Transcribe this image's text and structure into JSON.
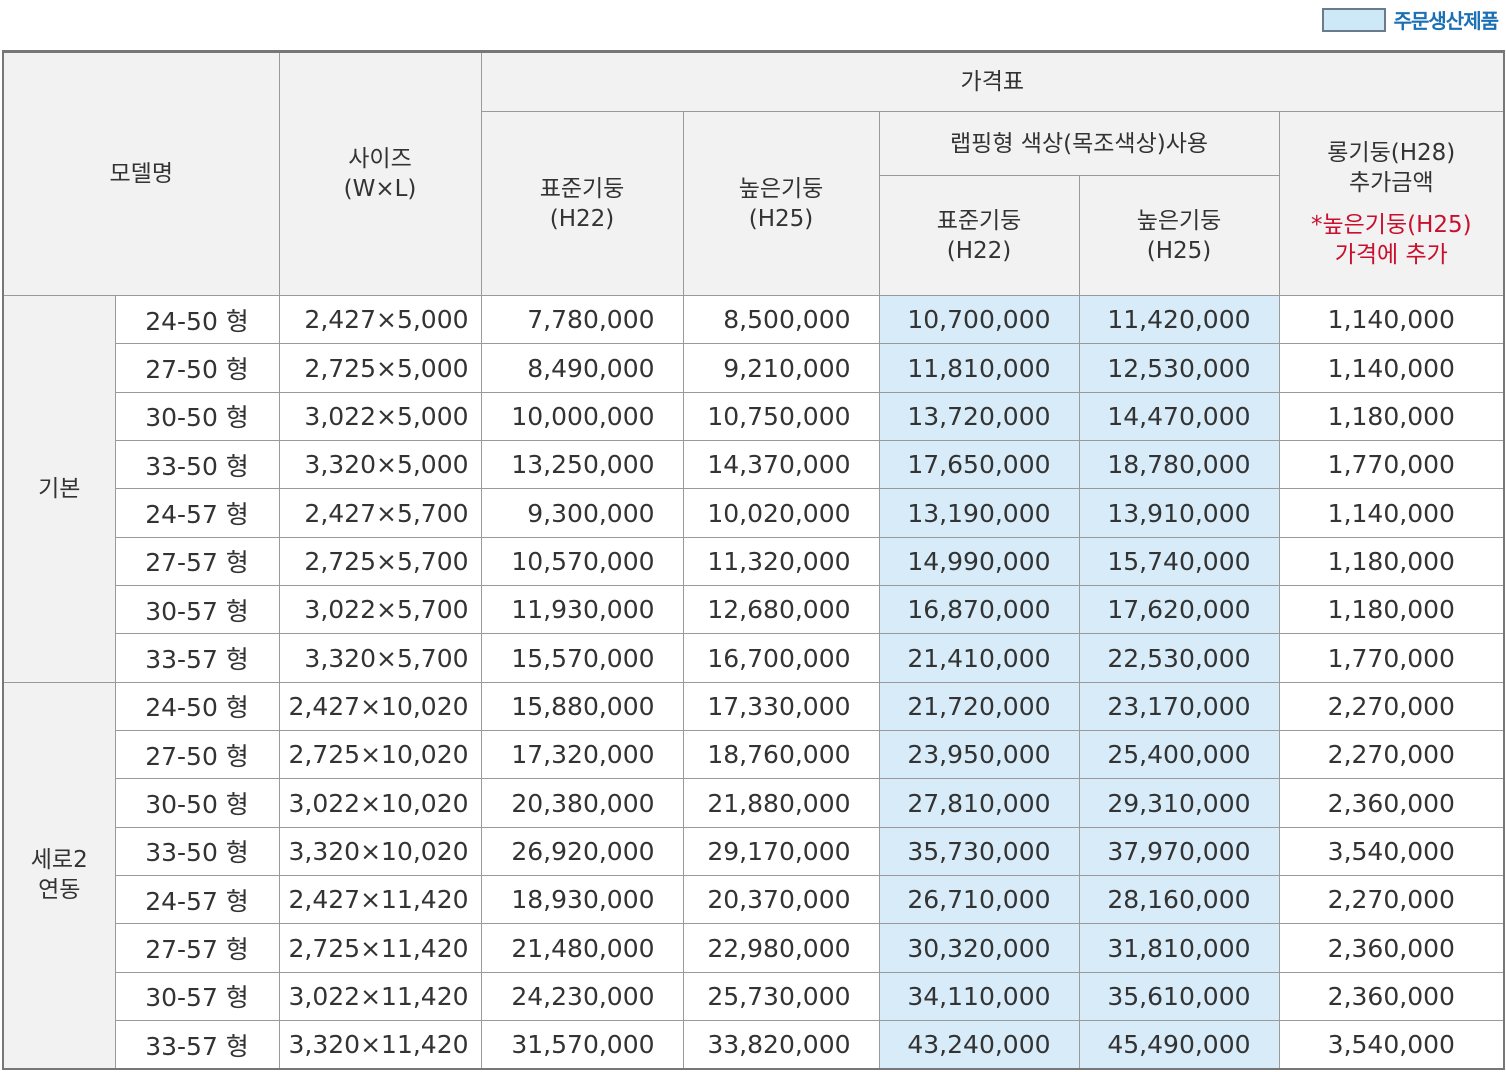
{
  "legend": {
    "label": "주문생산제품",
    "swatch_color": "#cde8f7"
  },
  "header": {
    "model": "모델명",
    "size_line1": "사이즈",
    "size_line2": "(W×L)",
    "price_table": "가격표",
    "standard_line1": "표준기둥",
    "standard_line2": "(H22)",
    "high_line1": "높은기둥",
    "high_line2": "(H25)",
    "wrapping": "랩핑형 색상(목조색상)사용",
    "wrap_standard_line1": "표준기둥",
    "wrap_standard_line2": "(H22)",
    "wrap_high_line1": "높은기둥",
    "wrap_high_line2": "(H25)",
    "long_line1": "롱기둥(H28)",
    "long_line2": "추가금액",
    "long_note_line1": "*높은기둥(H25)",
    "long_note_line2": "가격에 추가"
  },
  "groups": [
    {
      "name_line1": "기본",
      "name_line2": "",
      "rows": [
        {
          "model": "24-50 형",
          "size": "2,427×5,000",
          "std": "7,780,000",
          "high": "8,500,000",
          "wrap_std": "10,700,000",
          "wrap_high": "11,420,000",
          "long": "1,140,000"
        },
        {
          "model": "27-50 형",
          "size": "2,725×5,000",
          "std": "8,490,000",
          "high": "9,210,000",
          "wrap_std": "11,810,000",
          "wrap_high": "12,530,000",
          "long": "1,140,000"
        },
        {
          "model": "30-50 형",
          "size": "3,022×5,000",
          "std": "10,000,000",
          "high": "10,750,000",
          "wrap_std": "13,720,000",
          "wrap_high": "14,470,000",
          "long": "1,180,000"
        },
        {
          "model": "33-50 형",
          "size": "3,320×5,000",
          "std": "13,250,000",
          "high": "14,370,000",
          "wrap_std": "17,650,000",
          "wrap_high": "18,780,000",
          "long": "1,770,000"
        },
        {
          "model": "24-57 형",
          "size": "2,427×5,700",
          "std": "9,300,000",
          "high": "10,020,000",
          "wrap_std": "13,190,000",
          "wrap_high": "13,910,000",
          "long": "1,140,000"
        },
        {
          "model": "27-57 형",
          "size": "2,725×5,700",
          "std": "10,570,000",
          "high": "11,320,000",
          "wrap_std": "14,990,000",
          "wrap_high": "15,740,000",
          "long": "1,180,000"
        },
        {
          "model": "30-57 형",
          "size": "3,022×5,700",
          "std": "11,930,000",
          "high": "12,680,000",
          "wrap_std": "16,870,000",
          "wrap_high": "17,620,000",
          "long": "1,180,000"
        },
        {
          "model": "33-57 형",
          "size": "3,320×5,700",
          "std": "15,570,000",
          "high": "16,700,000",
          "wrap_std": "21,410,000",
          "wrap_high": "22,530,000",
          "long": "1,770,000"
        }
      ]
    },
    {
      "name_line1": "세로2",
      "name_line2": "연동",
      "rows": [
        {
          "model": "24-50 형",
          "size": "2,427×10,020",
          "std": "15,880,000",
          "high": "17,330,000",
          "wrap_std": "21,720,000",
          "wrap_high": "23,170,000",
          "long": "2,270,000"
        },
        {
          "model": "27-50 형",
          "size": "2,725×10,020",
          "std": "17,320,000",
          "high": "18,760,000",
          "wrap_std": "23,950,000",
          "wrap_high": "25,400,000",
          "long": "2,270,000"
        },
        {
          "model": "30-50 형",
          "size": "3,022×10,020",
          "std": "20,380,000",
          "high": "21,880,000",
          "wrap_std": "27,810,000",
          "wrap_high": "29,310,000",
          "long": "2,360,000"
        },
        {
          "model": "33-50 형",
          "size": "3,320×10,020",
          "std": "26,920,000",
          "high": "29,170,000",
          "wrap_std": "35,730,000",
          "wrap_high": "37,970,000",
          "long": "3,540,000"
        },
        {
          "model": "24-57 형",
          "size": "2,427×11,420",
          "std": "18,930,000",
          "high": "20,370,000",
          "wrap_std": "26,710,000",
          "wrap_high": "28,160,000",
          "long": "2,270,000"
        },
        {
          "model": "27-57 형",
          "size": "2,725×11,420",
          "std": "21,480,000",
          "high": "22,980,000",
          "wrap_std": "30,320,000",
          "wrap_high": "31,810,000",
          "long": "2,360,000"
        },
        {
          "model": "30-57 형",
          "size": "3,022×11,420",
          "std": "24,230,000",
          "high": "25,730,000",
          "wrap_std": "34,110,000",
          "wrap_high": "35,610,000",
          "long": "2,360,000"
        },
        {
          "model": "33-57 형",
          "size": "3,320×11,420",
          "std": "31,570,000",
          "high": "33,820,000",
          "wrap_std": "43,240,000",
          "wrap_high": "45,490,000",
          "long": "3,540,000"
        }
      ]
    }
  ]
}
